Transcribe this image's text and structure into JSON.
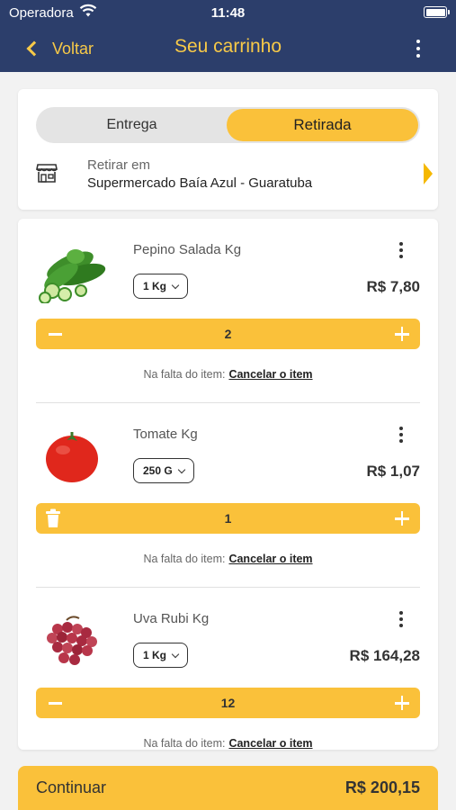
{
  "status_bar": {
    "carrier": "Operadora",
    "time": "11:48"
  },
  "nav": {
    "back_label": "Voltar",
    "title": "Seu carrinho"
  },
  "delivery_toggle": {
    "options": [
      "Entrega",
      "Retirada"
    ],
    "selected": "Retirada"
  },
  "pickup": {
    "title": "Retirar em",
    "store": "Supermercado Baía Azul - Guaratuba"
  },
  "shortage_prefix": "Na falta do item:",
  "shortage_action": "Cancelar o item",
  "items": [
    {
      "name": "Pepino Salada Kg",
      "unit": "1 Kg",
      "price": "R$ 7,80",
      "quantity": "2",
      "image": "cucumber"
    },
    {
      "name": "Tomate Kg",
      "unit": "250 G",
      "price": "R$ 1,07",
      "quantity": "1",
      "image": "tomato"
    },
    {
      "name": "Uva Rubi Kg",
      "unit": "1 Kg",
      "price": "R$ 164,28",
      "quantity": "12",
      "image": "grapes"
    }
  ],
  "footer": {
    "continue_label": "Continuar",
    "total": "R$ 200,15"
  },
  "colors": {
    "header": "#2c3e6b",
    "accent": "#fac13a",
    "accent_text": "#f7c948"
  }
}
